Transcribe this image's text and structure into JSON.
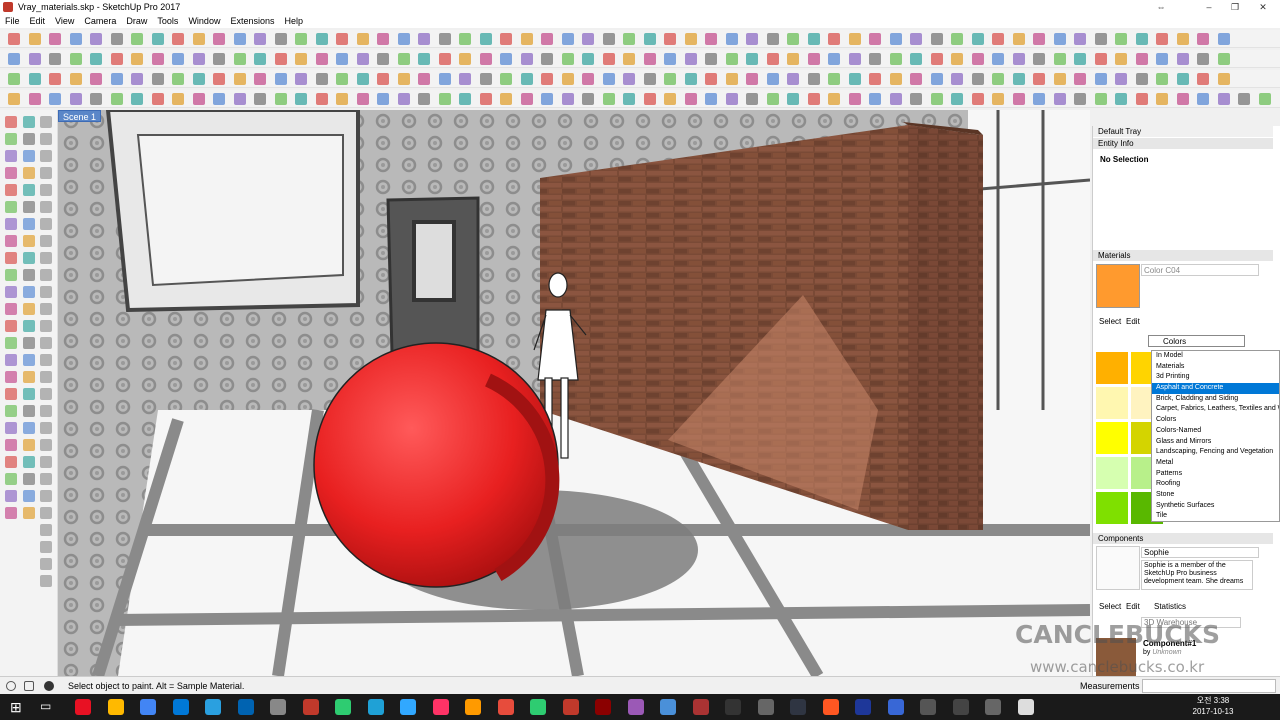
{
  "window": {
    "title": "Vray_materials.skp - SketchUp Pro 2017"
  },
  "menu": [
    "File",
    "Edit",
    "View",
    "Camera",
    "Draw",
    "Tools",
    "Window",
    "Extensions",
    "Help"
  ],
  "scene_tab": "Scene 1",
  "tray": {
    "title": "Default Tray",
    "entity_info": {
      "header": "Entity Info",
      "selection": "No Selection"
    },
    "materials": {
      "header": "Materials",
      "material_name": "Color C04",
      "material_color": "#ff9a2e",
      "tabs": [
        "Select",
        "Edit"
      ],
      "collection": "Colors",
      "dropdown_options": [
        "In Model",
        "Materials",
        "3d Printing",
        "Asphalt and Concrete",
        "Brick, Cladding and Siding",
        "Carpet, Fabrics, Leathers, Textiles and W",
        "Colors",
        "Colors-Named",
        "Glass and Mirrors",
        "Landscaping, Fencing and Vegetation",
        "Metal",
        "Patterns",
        "Roofing",
        "Stone",
        "Synthetic Surfaces",
        "Tile"
      ],
      "highlighted_option": "Asphalt and Concrete",
      "swatches": [
        "#ffb000",
        "#ffd400",
        "#fff7b0",
        "#fff3c0",
        "#ffff00",
        "#d4d400",
        "#d6ffb0",
        "#b8f08a",
        "#7fe000",
        "#59b800"
      ]
    },
    "components": {
      "header": "Components",
      "name": "Sophie",
      "description": "Sophie is a member of the SketchUp Pro business development team. She dreams",
      "tabs": [
        "Select",
        "Edit",
        "Statistics"
      ],
      "search_placeholder": "3D Warehouse",
      "item_title": "Component#1",
      "item_by": "by",
      "item_author": "Unknown"
    }
  },
  "status": {
    "hint": "Select object to paint. Alt = Sample Material.",
    "measurements_label": "Measurements"
  },
  "taskbar": {
    "time": "오전 3:38",
    "date": "2017-10-13"
  },
  "watermark": {
    "line1": "CANCLEBUCKS",
    "line2": "www.canclebucks.co.kr"
  }
}
